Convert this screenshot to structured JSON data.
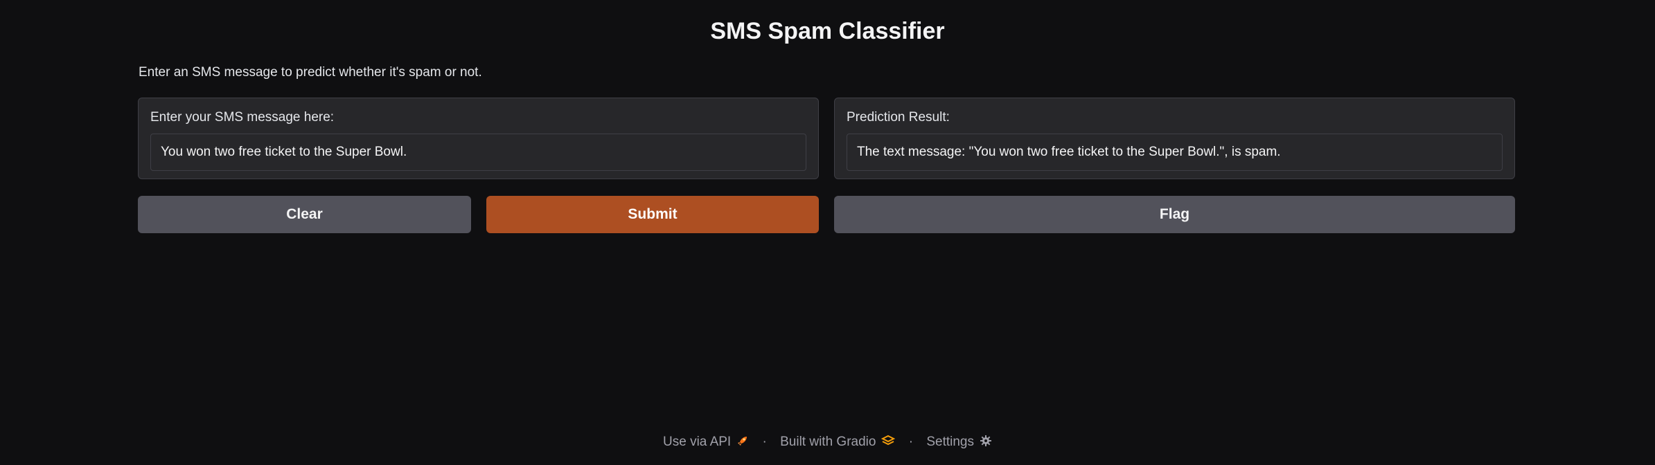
{
  "header": {
    "title": "SMS Spam Classifier",
    "description": "Enter an SMS message to predict whether it's spam or not."
  },
  "input_panel": {
    "label": "Enter your SMS message here:",
    "value": "You won two free ticket to the Super Bowl."
  },
  "output_panel": {
    "label": "Prediction Result:",
    "value": "The text message: \"You won two free ticket to the Super Bowl.\", is spam."
  },
  "buttons": {
    "clear": "Clear",
    "submit": "Submit",
    "flag": "Flag"
  },
  "footer": {
    "api_label": "Use via API",
    "api_icon": "rocket-icon",
    "separator": "·",
    "built_label": "Built with Gradio",
    "built_icon": "gradio-logo-icon",
    "settings_label": "Settings",
    "settings_icon": "gear-icon"
  },
  "colors": {
    "background": "#0f0f11",
    "panel": "#27272a",
    "accent": "#ad4f22",
    "secondary_button": "#52525b"
  }
}
